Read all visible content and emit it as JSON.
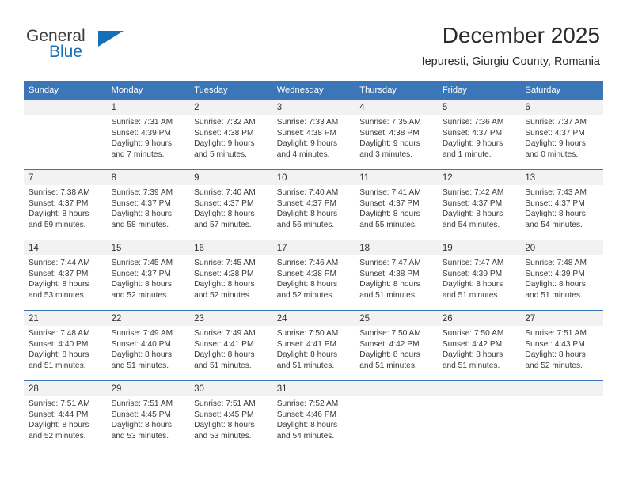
{
  "logo": {
    "word1": "General",
    "word2": "Blue",
    "accent_color": "#1570b8",
    "mark": "triangle-mark"
  },
  "header": {
    "title": "December 2025",
    "subtitle": "Iepuresti, Giurgiu County, Romania"
  },
  "calendar": {
    "header_bg": "#3b77b8",
    "daynum_bg": "#f2f2f2",
    "weekdays": [
      "Sunday",
      "Monday",
      "Tuesday",
      "Wednesday",
      "Thursday",
      "Friday",
      "Saturday"
    ],
    "weeks": [
      [
        {
          "day": "",
          "lines": []
        },
        {
          "day": "1",
          "lines": [
            "Sunrise: 7:31 AM",
            "Sunset: 4:39 PM",
            "Daylight: 9 hours",
            "and 7 minutes."
          ]
        },
        {
          "day": "2",
          "lines": [
            "Sunrise: 7:32 AM",
            "Sunset: 4:38 PM",
            "Daylight: 9 hours",
            "and 5 minutes."
          ]
        },
        {
          "day": "3",
          "lines": [
            "Sunrise: 7:33 AM",
            "Sunset: 4:38 PM",
            "Daylight: 9 hours",
            "and 4 minutes."
          ]
        },
        {
          "day": "4",
          "lines": [
            "Sunrise: 7:35 AM",
            "Sunset: 4:38 PM",
            "Daylight: 9 hours",
            "and 3 minutes."
          ]
        },
        {
          "day": "5",
          "lines": [
            "Sunrise: 7:36 AM",
            "Sunset: 4:37 PM",
            "Daylight: 9 hours",
            "and 1 minute."
          ]
        },
        {
          "day": "6",
          "lines": [
            "Sunrise: 7:37 AM",
            "Sunset: 4:37 PM",
            "Daylight: 9 hours",
            "and 0 minutes."
          ]
        }
      ],
      [
        {
          "day": "7",
          "lines": [
            "Sunrise: 7:38 AM",
            "Sunset: 4:37 PM",
            "Daylight: 8 hours",
            "and 59 minutes."
          ]
        },
        {
          "day": "8",
          "lines": [
            "Sunrise: 7:39 AM",
            "Sunset: 4:37 PM",
            "Daylight: 8 hours",
            "and 58 minutes."
          ]
        },
        {
          "day": "9",
          "lines": [
            "Sunrise: 7:40 AM",
            "Sunset: 4:37 PM",
            "Daylight: 8 hours",
            "and 57 minutes."
          ]
        },
        {
          "day": "10",
          "lines": [
            "Sunrise: 7:40 AM",
            "Sunset: 4:37 PM",
            "Daylight: 8 hours",
            "and 56 minutes."
          ]
        },
        {
          "day": "11",
          "lines": [
            "Sunrise: 7:41 AM",
            "Sunset: 4:37 PM",
            "Daylight: 8 hours",
            "and 55 minutes."
          ]
        },
        {
          "day": "12",
          "lines": [
            "Sunrise: 7:42 AM",
            "Sunset: 4:37 PM",
            "Daylight: 8 hours",
            "and 54 minutes."
          ]
        },
        {
          "day": "13",
          "lines": [
            "Sunrise: 7:43 AM",
            "Sunset: 4:37 PM",
            "Daylight: 8 hours",
            "and 54 minutes."
          ]
        }
      ],
      [
        {
          "day": "14",
          "lines": [
            "Sunrise: 7:44 AM",
            "Sunset: 4:37 PM",
            "Daylight: 8 hours",
            "and 53 minutes."
          ]
        },
        {
          "day": "15",
          "lines": [
            "Sunrise: 7:45 AM",
            "Sunset: 4:37 PM",
            "Daylight: 8 hours",
            "and 52 minutes."
          ]
        },
        {
          "day": "16",
          "lines": [
            "Sunrise: 7:45 AM",
            "Sunset: 4:38 PM",
            "Daylight: 8 hours",
            "and 52 minutes."
          ]
        },
        {
          "day": "17",
          "lines": [
            "Sunrise: 7:46 AM",
            "Sunset: 4:38 PM",
            "Daylight: 8 hours",
            "and 52 minutes."
          ]
        },
        {
          "day": "18",
          "lines": [
            "Sunrise: 7:47 AM",
            "Sunset: 4:38 PM",
            "Daylight: 8 hours",
            "and 51 minutes."
          ]
        },
        {
          "day": "19",
          "lines": [
            "Sunrise: 7:47 AM",
            "Sunset: 4:39 PM",
            "Daylight: 8 hours",
            "and 51 minutes."
          ]
        },
        {
          "day": "20",
          "lines": [
            "Sunrise: 7:48 AM",
            "Sunset: 4:39 PM",
            "Daylight: 8 hours",
            "and 51 minutes."
          ]
        }
      ],
      [
        {
          "day": "21",
          "lines": [
            "Sunrise: 7:48 AM",
            "Sunset: 4:40 PM",
            "Daylight: 8 hours",
            "and 51 minutes."
          ]
        },
        {
          "day": "22",
          "lines": [
            "Sunrise: 7:49 AM",
            "Sunset: 4:40 PM",
            "Daylight: 8 hours",
            "and 51 minutes."
          ]
        },
        {
          "day": "23",
          "lines": [
            "Sunrise: 7:49 AM",
            "Sunset: 4:41 PM",
            "Daylight: 8 hours",
            "and 51 minutes."
          ]
        },
        {
          "day": "24",
          "lines": [
            "Sunrise: 7:50 AM",
            "Sunset: 4:41 PM",
            "Daylight: 8 hours",
            "and 51 minutes."
          ]
        },
        {
          "day": "25",
          "lines": [
            "Sunrise: 7:50 AM",
            "Sunset: 4:42 PM",
            "Daylight: 8 hours",
            "and 51 minutes."
          ]
        },
        {
          "day": "26",
          "lines": [
            "Sunrise: 7:50 AM",
            "Sunset: 4:42 PM",
            "Daylight: 8 hours",
            "and 51 minutes."
          ]
        },
        {
          "day": "27",
          "lines": [
            "Sunrise: 7:51 AM",
            "Sunset: 4:43 PM",
            "Daylight: 8 hours",
            "and 52 minutes."
          ]
        }
      ],
      [
        {
          "day": "28",
          "lines": [
            "Sunrise: 7:51 AM",
            "Sunset: 4:44 PM",
            "Daylight: 8 hours",
            "and 52 minutes."
          ]
        },
        {
          "day": "29",
          "lines": [
            "Sunrise: 7:51 AM",
            "Sunset: 4:45 PM",
            "Daylight: 8 hours",
            "and 53 minutes."
          ]
        },
        {
          "day": "30",
          "lines": [
            "Sunrise: 7:51 AM",
            "Sunset: 4:45 PM",
            "Daylight: 8 hours",
            "and 53 minutes."
          ]
        },
        {
          "day": "31",
          "lines": [
            "Sunrise: 7:52 AM",
            "Sunset: 4:46 PM",
            "Daylight: 8 hours",
            "and 54 minutes."
          ]
        },
        {
          "day": "",
          "lines": []
        },
        {
          "day": "",
          "lines": []
        },
        {
          "day": "",
          "lines": []
        }
      ]
    ]
  }
}
